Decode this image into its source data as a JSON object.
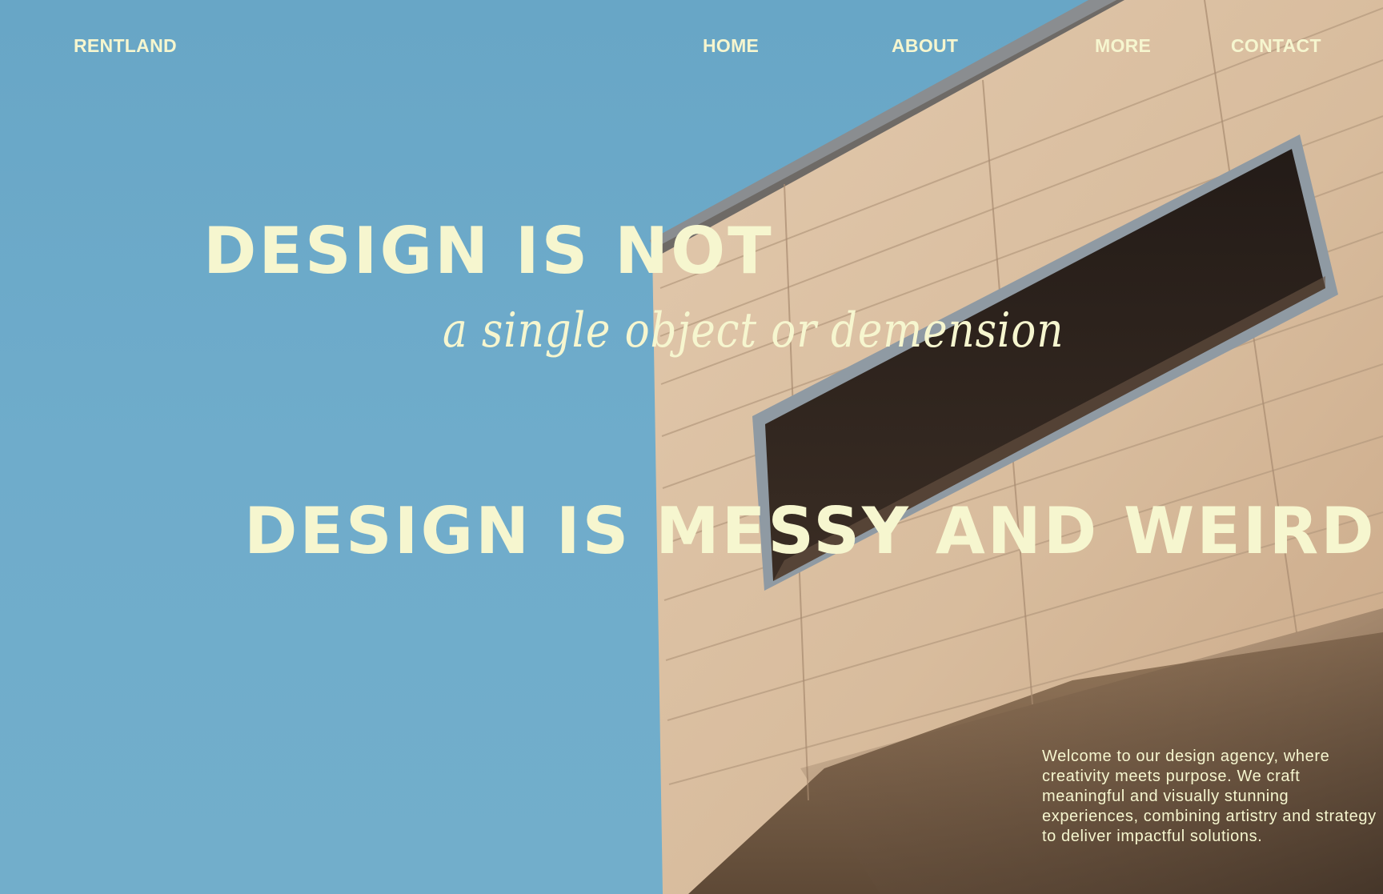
{
  "brand": {
    "name": "RENTLAND"
  },
  "nav": {
    "items": [
      {
        "label": "HOME"
      },
      {
        "label": "ABOUT"
      },
      {
        "label": "MORE"
      },
      {
        "label": "CONTACT"
      }
    ]
  },
  "hero": {
    "headline_1": "DESIGN IS NOT",
    "subline": "a single object or demension",
    "headline_2": "DESIGN IS MESSY AND WEIRD",
    "intro": "Welcome to our design agency, where creativity meets purpose. We craft meaningful and visually stunning experiences, combining artistry and strategy to deliver impactful solutions."
  },
  "colors": {
    "sky": "#6ea8c7",
    "text_cream": "#f6f6cf",
    "facade": "#d9bd9f",
    "facade_shadow": "#8a6d52",
    "window_dark": "#1e1714",
    "window_frame": "#8f9aa3"
  },
  "background_image": {
    "subject": "building-facade-with-window"
  }
}
